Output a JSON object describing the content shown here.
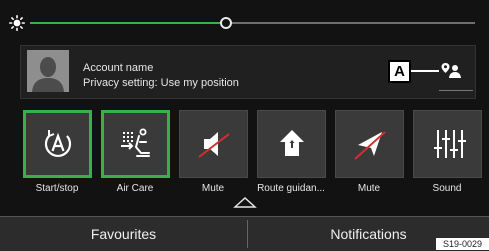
{
  "brightness": {
    "level_fraction": 0.44
  },
  "account": {
    "name": "Account name",
    "privacy": "Privacy setting: Use my position",
    "callout_label": "A"
  },
  "tiles": [
    {
      "label": "Start/stop",
      "icon": "start-stop-icon",
      "active": true
    },
    {
      "label": "Air Care",
      "icon": "air-care-icon",
      "active": true
    },
    {
      "label": "Mute",
      "icon": "speaker-muted-icon",
      "active": false
    },
    {
      "label": "Route guidan...",
      "icon": "route-guidance-icon",
      "active": false
    },
    {
      "label": "Mute",
      "icon": "navigation-muted-icon",
      "active": false
    },
    {
      "label": "Sound",
      "icon": "equalizer-icon",
      "active": false
    }
  ],
  "tabs": {
    "favourites": "Favourites",
    "notifications": "Notifications"
  },
  "figure_code": "S19-0029",
  "colors": {
    "accent": "#36b24a",
    "background": "#121212",
    "tile": "#3a3a3a"
  }
}
